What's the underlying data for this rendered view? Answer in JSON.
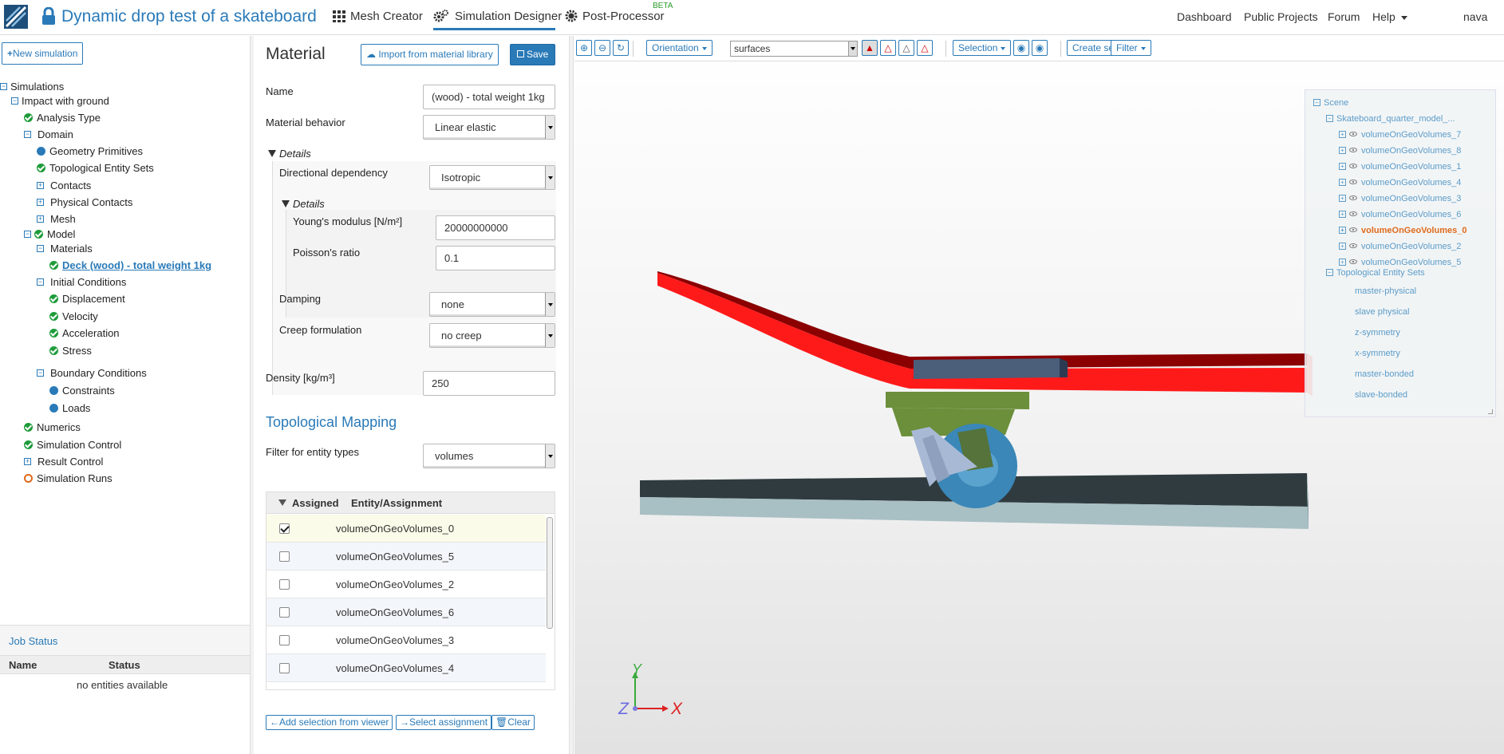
{
  "header": {
    "title": "Dynamic drop test of a skateboard",
    "tabs": [
      {
        "label": "Mesh Creator",
        "icon": "grid-icon"
      },
      {
        "label": "Simulation Designer",
        "icon": "gears-icon"
      },
      {
        "label": "Post-Processor",
        "icon": "gear-icon"
      }
    ],
    "beta": "BETA",
    "right_nav": [
      "Dashboard",
      "Public Projects",
      "Forum",
      "Help",
      "nava"
    ]
  },
  "left": {
    "new_sim_label": "New simulation",
    "tree": {
      "root": "Simulations",
      "sim": "Impact with ground",
      "analysis": "Analysis Type",
      "domain": "Domain",
      "geom": "Geometry Primitives",
      "tes": "Topological Entity Sets",
      "contacts": "Contacts",
      "phys": "Physical Contacts",
      "mesh": "Mesh",
      "model": "Model",
      "materials": "Materials",
      "deck": "Deck (wood) - total weight 1kg",
      "ic": "Initial Conditions",
      "disp": "Displacement",
      "vel": "Velocity",
      "acc": "Acceleration",
      "stress": "Stress",
      "bc": "Boundary Conditions",
      "constraints": "Constraints",
      "loads": "Loads",
      "numerics": "Numerics",
      "simctrl": "Simulation Control",
      "result": "Result Control",
      "runs": "Simulation Runs"
    },
    "job_status": {
      "title": "Job Status",
      "col_name": "Name",
      "col_status": "Status",
      "empty": "no entities available"
    }
  },
  "material": {
    "title": "Material",
    "import_label": "Import from material library",
    "save_label": "Save",
    "name_label": "Name",
    "name_value": "(wood) - total weight 1kg",
    "behavior_label": "Material behavior",
    "behavior_value": "Linear elastic",
    "details_label": "Details",
    "dir_dep_label": "Directional dependency",
    "dir_dep_value": "Isotropic",
    "details2_label": "Details",
    "youngs_label": "Young's modulus [N/m²]",
    "youngs_value": "20000000000",
    "poisson_label": "Poisson's ratio",
    "poisson_value": "0.1",
    "damping_label": "Damping",
    "damping_value": "none",
    "creep_label": "Creep formulation",
    "creep_value": "no creep",
    "density_label": "Density [kg/m³]",
    "density_value": "250"
  },
  "mapping": {
    "title": "Topological Mapping",
    "filter_label": "Filter for entity types",
    "filter_value": "volumes",
    "col_assigned": "Assigned",
    "col_entity": "Entity/Assignment",
    "rows": [
      {
        "name": "volumeOnGeoVolumes_0",
        "checked": true
      },
      {
        "name": "volumeOnGeoVolumes_5",
        "checked": false
      },
      {
        "name": "volumeOnGeoVolumes_2",
        "checked": false
      },
      {
        "name": "volumeOnGeoVolumes_6",
        "checked": false
      },
      {
        "name": "volumeOnGeoVolumes_3",
        "checked": false
      },
      {
        "name": "volumeOnGeoVolumes_4",
        "checked": false
      }
    ],
    "add_sel_label": "Add selection from viewer",
    "select_assign_label": "Select assignment",
    "clear_label": "Clear"
  },
  "viewer": {
    "orientation_label": "Orientation",
    "render_mode": "surfaces",
    "selection_label": "Selection",
    "create_set_label": "Create set",
    "filter_label": "Filter",
    "axes": {
      "x": "X",
      "y": "Y",
      "z": "Z"
    },
    "scene": {
      "root": "Scene",
      "model": "Skateboard_quarter_model_...",
      "volumes": [
        "volumeOnGeoVolumes_7",
        "volumeOnGeoVolumes_8",
        "volumeOnGeoVolumes_1",
        "volumeOnGeoVolumes_4",
        "volumeOnGeoVolumes_3",
        "volumeOnGeoVolumes_6",
        "volumeOnGeoVolumes_0",
        "volumeOnGeoVolumes_2",
        "volumeOnGeoVolumes_5"
      ],
      "tes_root": "Topological Entity Sets",
      "sets": [
        "master-physical",
        "slave physical",
        "z-symmetry",
        "x-symmetry",
        "master-bonded",
        "slave-bonded"
      ]
    },
    "colors": {
      "deck": "#ff1a1a",
      "deck_dark": "#8b0000",
      "truck": "#6b8f3a",
      "wheel": "#3a87b8",
      "ground": "#2f3b3f",
      "ground_side": "#a8bfc4"
    }
  }
}
